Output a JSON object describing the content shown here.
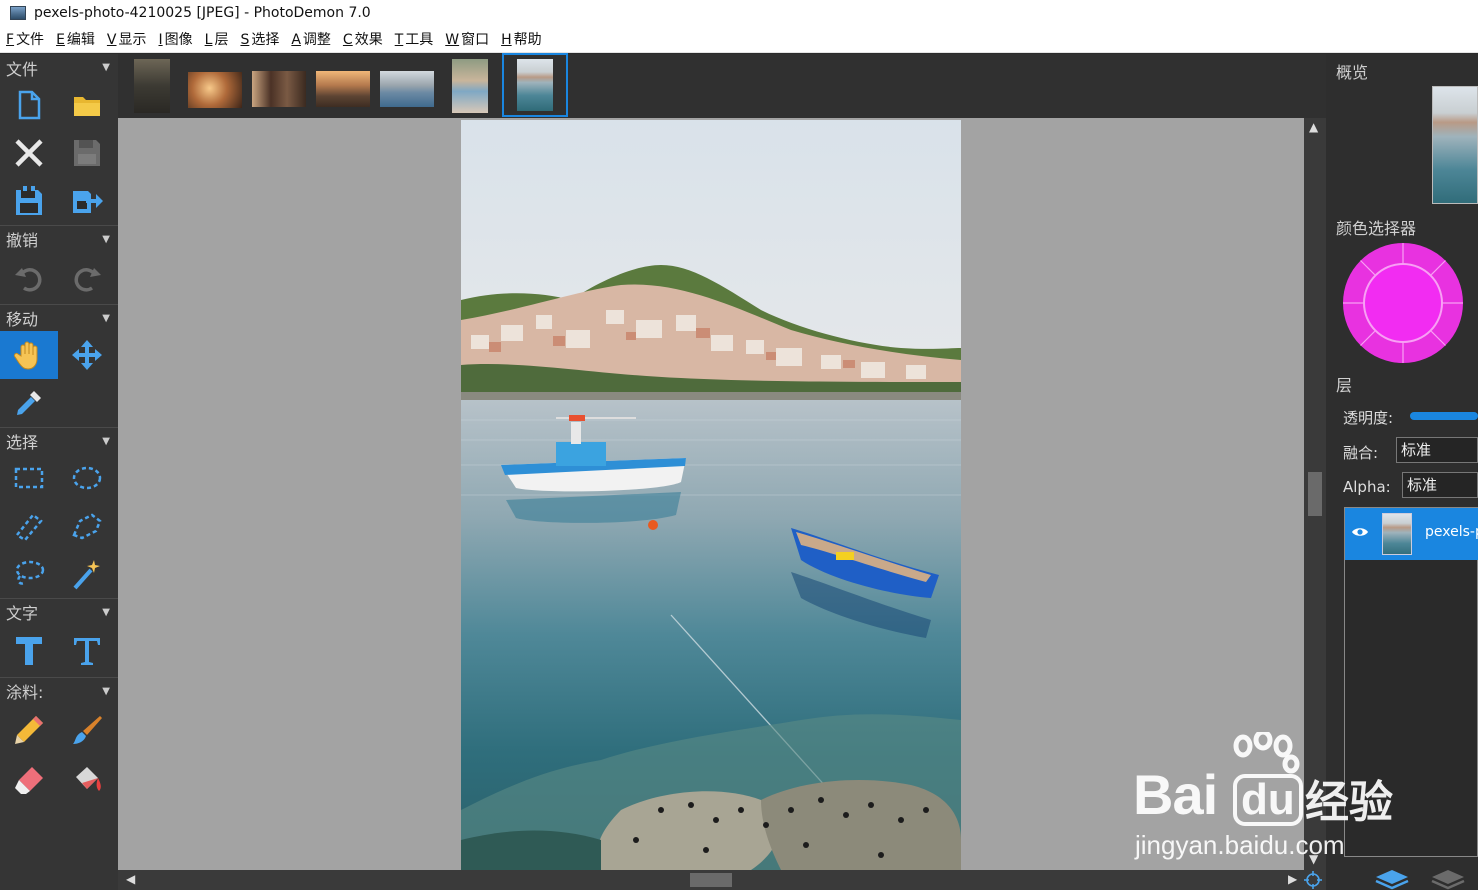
{
  "window": {
    "title": "pexels-photo-4210025 [JPEG]  -  PhotoDemon 7.0"
  },
  "menu": [
    {
      "key": "F",
      "label": "文件"
    },
    {
      "key": "E",
      "label": "编辑"
    },
    {
      "key": "V",
      "label": "显示"
    },
    {
      "key": "I",
      "label": "图像"
    },
    {
      "key": "L",
      "label": "层"
    },
    {
      "key": "S",
      "label": "选择"
    },
    {
      "key": "A",
      "label": "调整"
    },
    {
      "key": "C",
      "label": "效果"
    },
    {
      "key": "T",
      "label": "工具"
    },
    {
      "key": "W",
      "label": "窗口"
    },
    {
      "key": "H",
      "label": "帮助"
    }
  ],
  "toolbox": {
    "file": "文件",
    "undo": "撤销",
    "move": "移动",
    "select": "选择",
    "text": "文字",
    "paint": "涂料:"
  },
  "right_panel": {
    "overview": "概览",
    "color_picker": "颜色选择器",
    "layers": "层",
    "opacity_label": "透明度:",
    "blend_label": "融合:",
    "blend_value": "标准",
    "alpha_label": "Alpha:",
    "alpha_value": "标准",
    "layer_name": "pexels-p",
    "picker_color": "#f22cf2"
  },
  "colors": {
    "accent": "#1a86e0",
    "panel": "#353535",
    "canvas_bg": "#a3a3a3"
  },
  "watermark": {
    "brand": "Bai",
    "brand_du": "du",
    "cn": "经验",
    "url": "jingyan.baidu.com"
  }
}
